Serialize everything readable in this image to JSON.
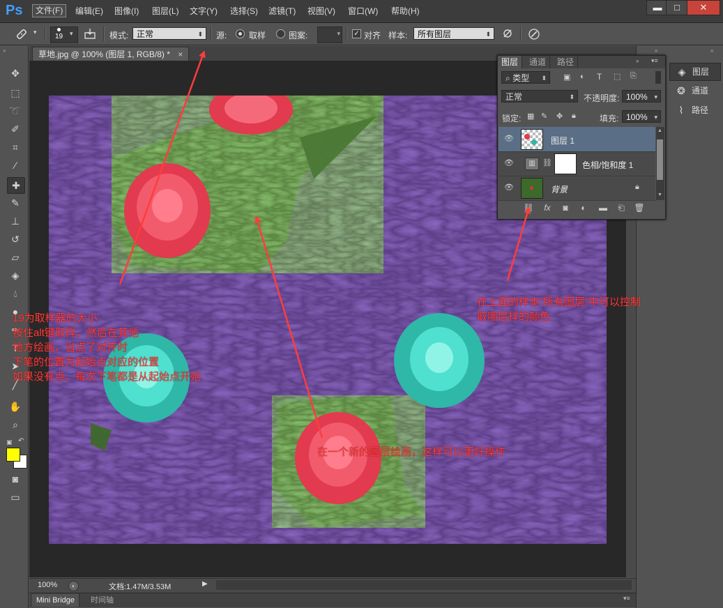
{
  "app": {
    "logo": "Ps"
  },
  "menu": {
    "items": [
      "文件(F)",
      "编辑(E)",
      "图像(I)",
      "图层(L)",
      "文字(Y)",
      "选择(S)",
      "滤镜(T)",
      "视图(V)",
      "窗口(W)",
      "帮助(H)"
    ],
    "active_index": 0
  },
  "window_controls": {
    "minimize": "▬",
    "maximize": "□",
    "close": "✕"
  },
  "options_bar": {
    "brush_size": "19",
    "mode_label": "模式:",
    "mode_value": "正常",
    "source_label": "源:",
    "sampled_label": "取样",
    "pattern_label": "图案:",
    "aligned_label": "对齐",
    "sample_label": "样本:",
    "sample_value": "所有图层"
  },
  "document": {
    "tab_title": "草地.jpg @ 100% (图层 1, RGB/8) *",
    "tab_close": "×",
    "zoom": "100%",
    "doc_info": "文档:1.47M/3.53M"
  },
  "bottom_tabs": [
    "Mini Bridge",
    "时间轴"
  ],
  "layers_panel": {
    "tabs": [
      "图层",
      "通道",
      "路径"
    ],
    "filter_label": "类型",
    "blend_mode": "正常",
    "opacity_label": "不透明度:",
    "opacity_value": "100%",
    "lock_label": "锁定:",
    "fill_label": "填充:",
    "fill_value": "100%",
    "layers": [
      {
        "name": "图层 1",
        "selected": true
      },
      {
        "name": "色相/饱和度 1",
        "selected": false
      },
      {
        "name": "背景",
        "selected": false
      }
    ]
  },
  "right_panels": [
    {
      "label": "图层",
      "icon": "layers-icon"
    },
    {
      "label": "通道",
      "icon": "channels-icon"
    },
    {
      "label": "路径",
      "icon": "paths-icon"
    }
  ],
  "colors": {
    "foreground": "#ffff00",
    "background": "#ffffff",
    "annotation": "#ff3d3d",
    "accent": "#3fa0ff"
  },
  "annotations": {
    "left_lines": [
      "19为取样器的大小",
      "按住alt键取样，然后在其他",
      "地方绘画，当点了对齐时",
      "下笔的位置为起始点对应的位置",
      "如果没有点，每次下笔都是从起始点开始"
    ],
    "right_lines": [
      "在上面的样本“所有图层”中可以控制",
      "取哪层样的颜色"
    ],
    "bottom_line": "在一个新的图层绘画，这样可以更好操作"
  }
}
